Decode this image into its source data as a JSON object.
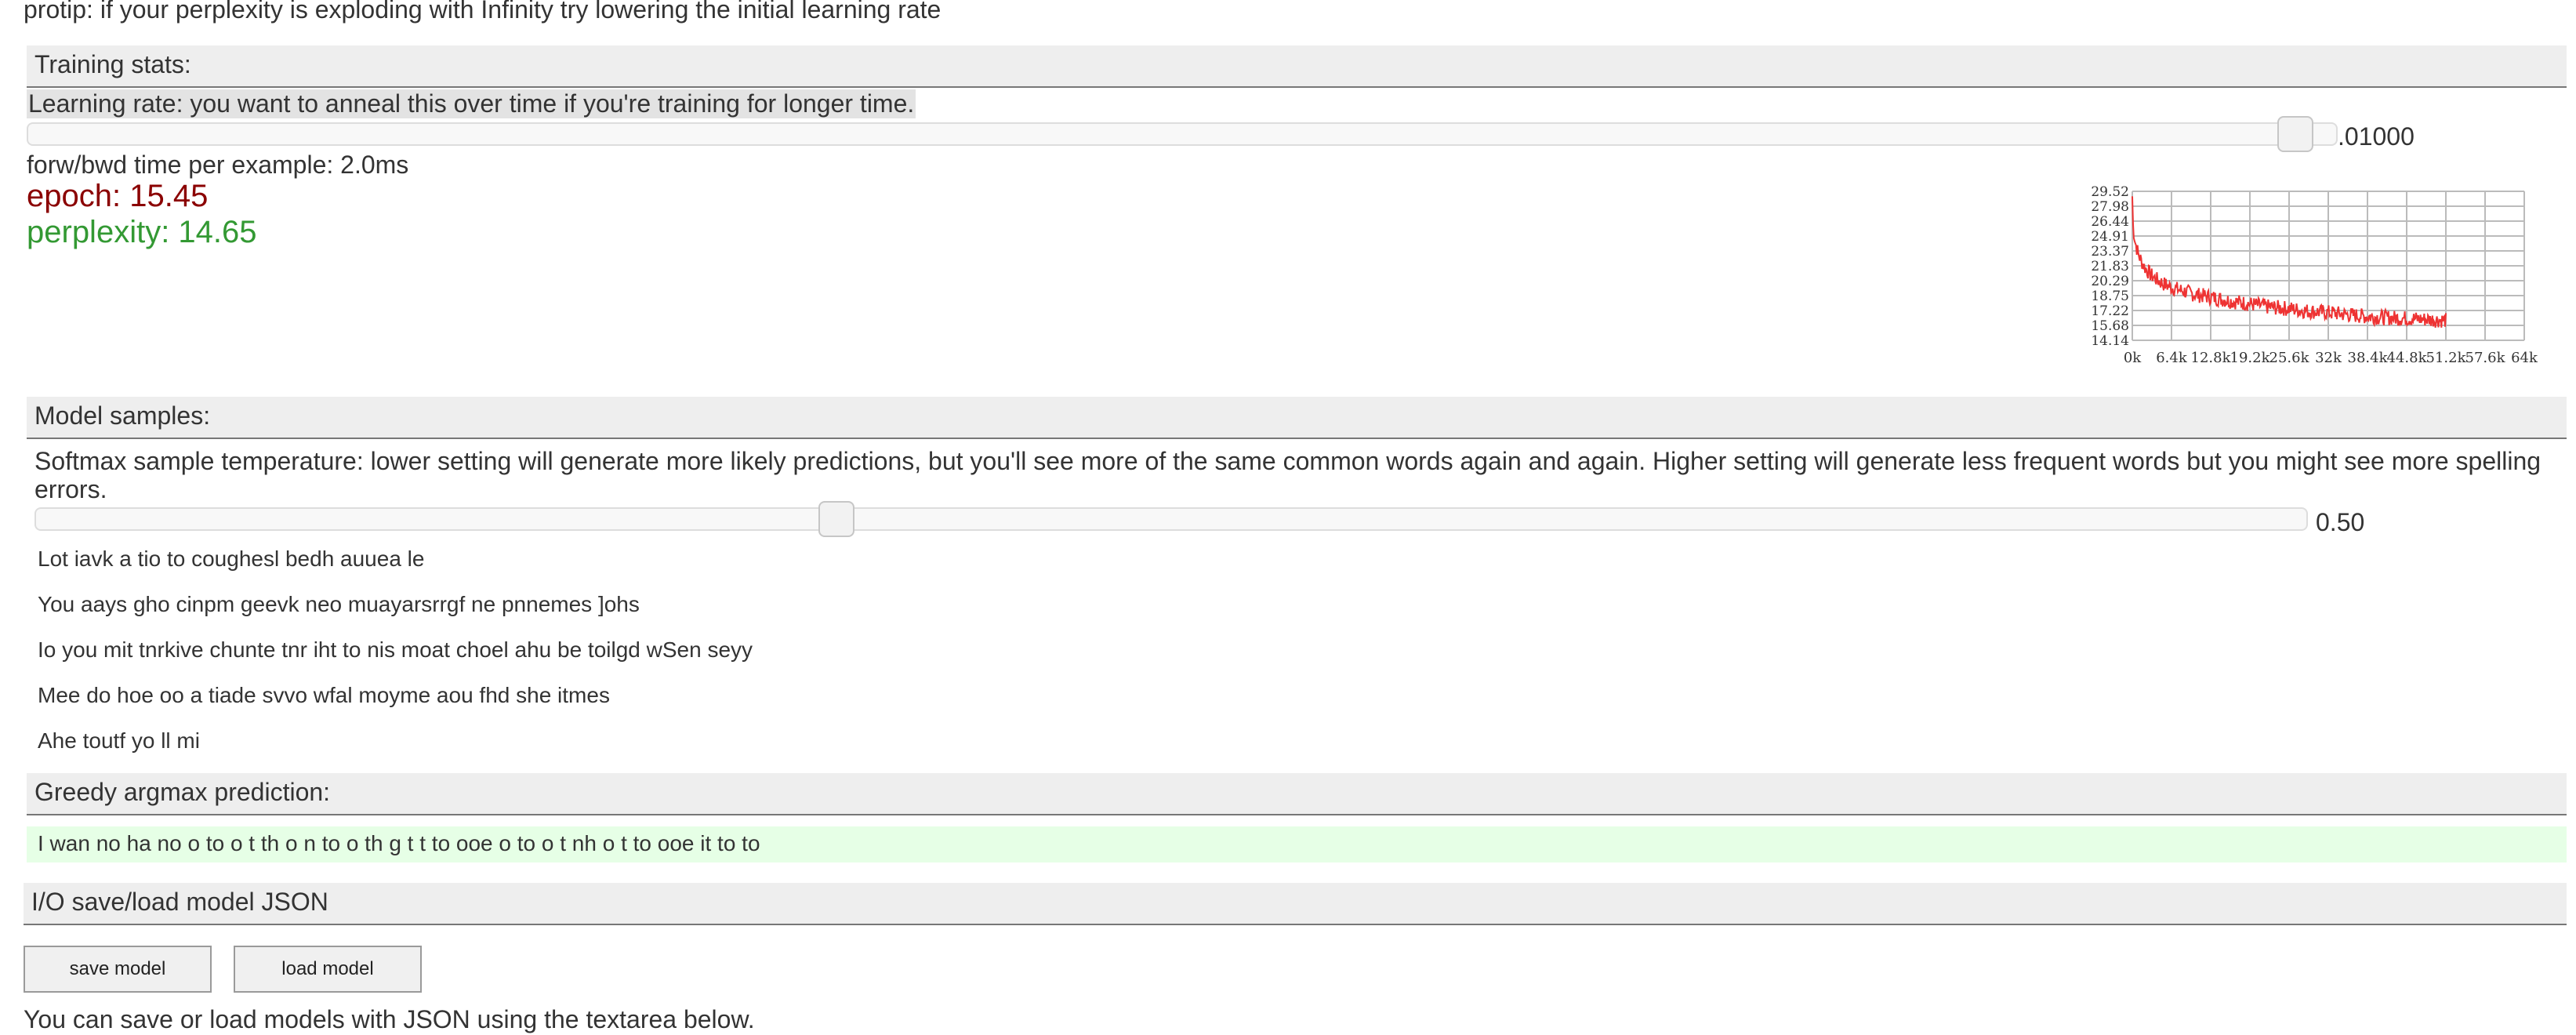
{
  "protip": "protip: if your perplexity is exploding with Infinity try lowering the initial learning rate",
  "training": {
    "header": "Training stats:",
    "lr_label": "Learning rate: you want to anneal this over time if you're training for longer time.",
    "lr_value": ".01000",
    "lr_slider_fraction": 0.99,
    "fwbw_time": "forw/bwd time per example: 2.0ms",
    "epoch": "epoch: 15.45",
    "perplexity": "perplexity: 14.65"
  },
  "chart_data": {
    "type": "line",
    "title": "",
    "xlabel": "",
    "ylabel": "",
    "y_ticks": [
      "29.52",
      "27.98",
      "26.44",
      "24.91",
      "23.37",
      "21.83",
      "20.29",
      "18.75",
      "17.22",
      "15.68",
      "14.14"
    ],
    "x_ticks": [
      "0k",
      "6.4k",
      "12.8k",
      "19.2k",
      "25.6k",
      "32k",
      "38.4k",
      "44.8k",
      "51.2k",
      "57.6k",
      "64k"
    ],
    "ylim": [
      14.14,
      29.52
    ],
    "xlim": [
      0,
      64000
    ],
    "grid": true,
    "series": [
      {
        "color": "#ee3333",
        "x": [
          0,
          200,
          500,
          1000,
          1500,
          2000,
          3000,
          4000,
          5000,
          6400,
          8000,
          10000,
          12800,
          16000,
          19200,
          22000,
          25600,
          28000,
          32000,
          35000,
          38400,
          41000,
          44800,
          48000,
          51200,
          51200
        ],
        "y": [
          26.8,
          25.5,
          24.2,
          23.0,
          22.3,
          21.7,
          20.9,
          20.4,
          20.0,
          19.6,
          19.3,
          18.9,
          18.6,
          18.2,
          17.9,
          17.6,
          17.4,
          17.2,
          17.0,
          16.8,
          16.6,
          16.5,
          16.4,
          16.3,
          16.2,
          16.2
        ],
        "noise": 0.8
      }
    ]
  },
  "samples": {
    "header": "Model samples:",
    "temp_label": "Softmax sample temperature: lower setting will generate more likely predictions, but you'll see more of the same common words again and again. Higher setting will generate less frequent words but you might see more spelling errors.",
    "temp_value": "0.50",
    "temp_slider_fraction": 0.35,
    "items": [
      "Lot iavk a tio to coughesl bedh auuea le",
      "You aays gho cinpm geevk neo muayarsrrgf ne pnnemes ]ohs",
      "Io you mit tnrkive chunte tnr iht to nis moat choel ahu be toilgd wSen seyy",
      "Mee do hoe oo a tiade svvo wfal moyme aou fhd she itmes",
      "Ahe toutf yo ll mi"
    ]
  },
  "greedy": {
    "header": "Greedy argmax prediction:",
    "text": "I wan no ha no o to o t th o n to o th g t t to ooe o to o t nh o t to ooe it to to"
  },
  "io": {
    "header": "I/O save/load model JSON",
    "save_label": "save model",
    "load_label": "load model",
    "footer": "You can save or load models with JSON using the textarea below."
  }
}
